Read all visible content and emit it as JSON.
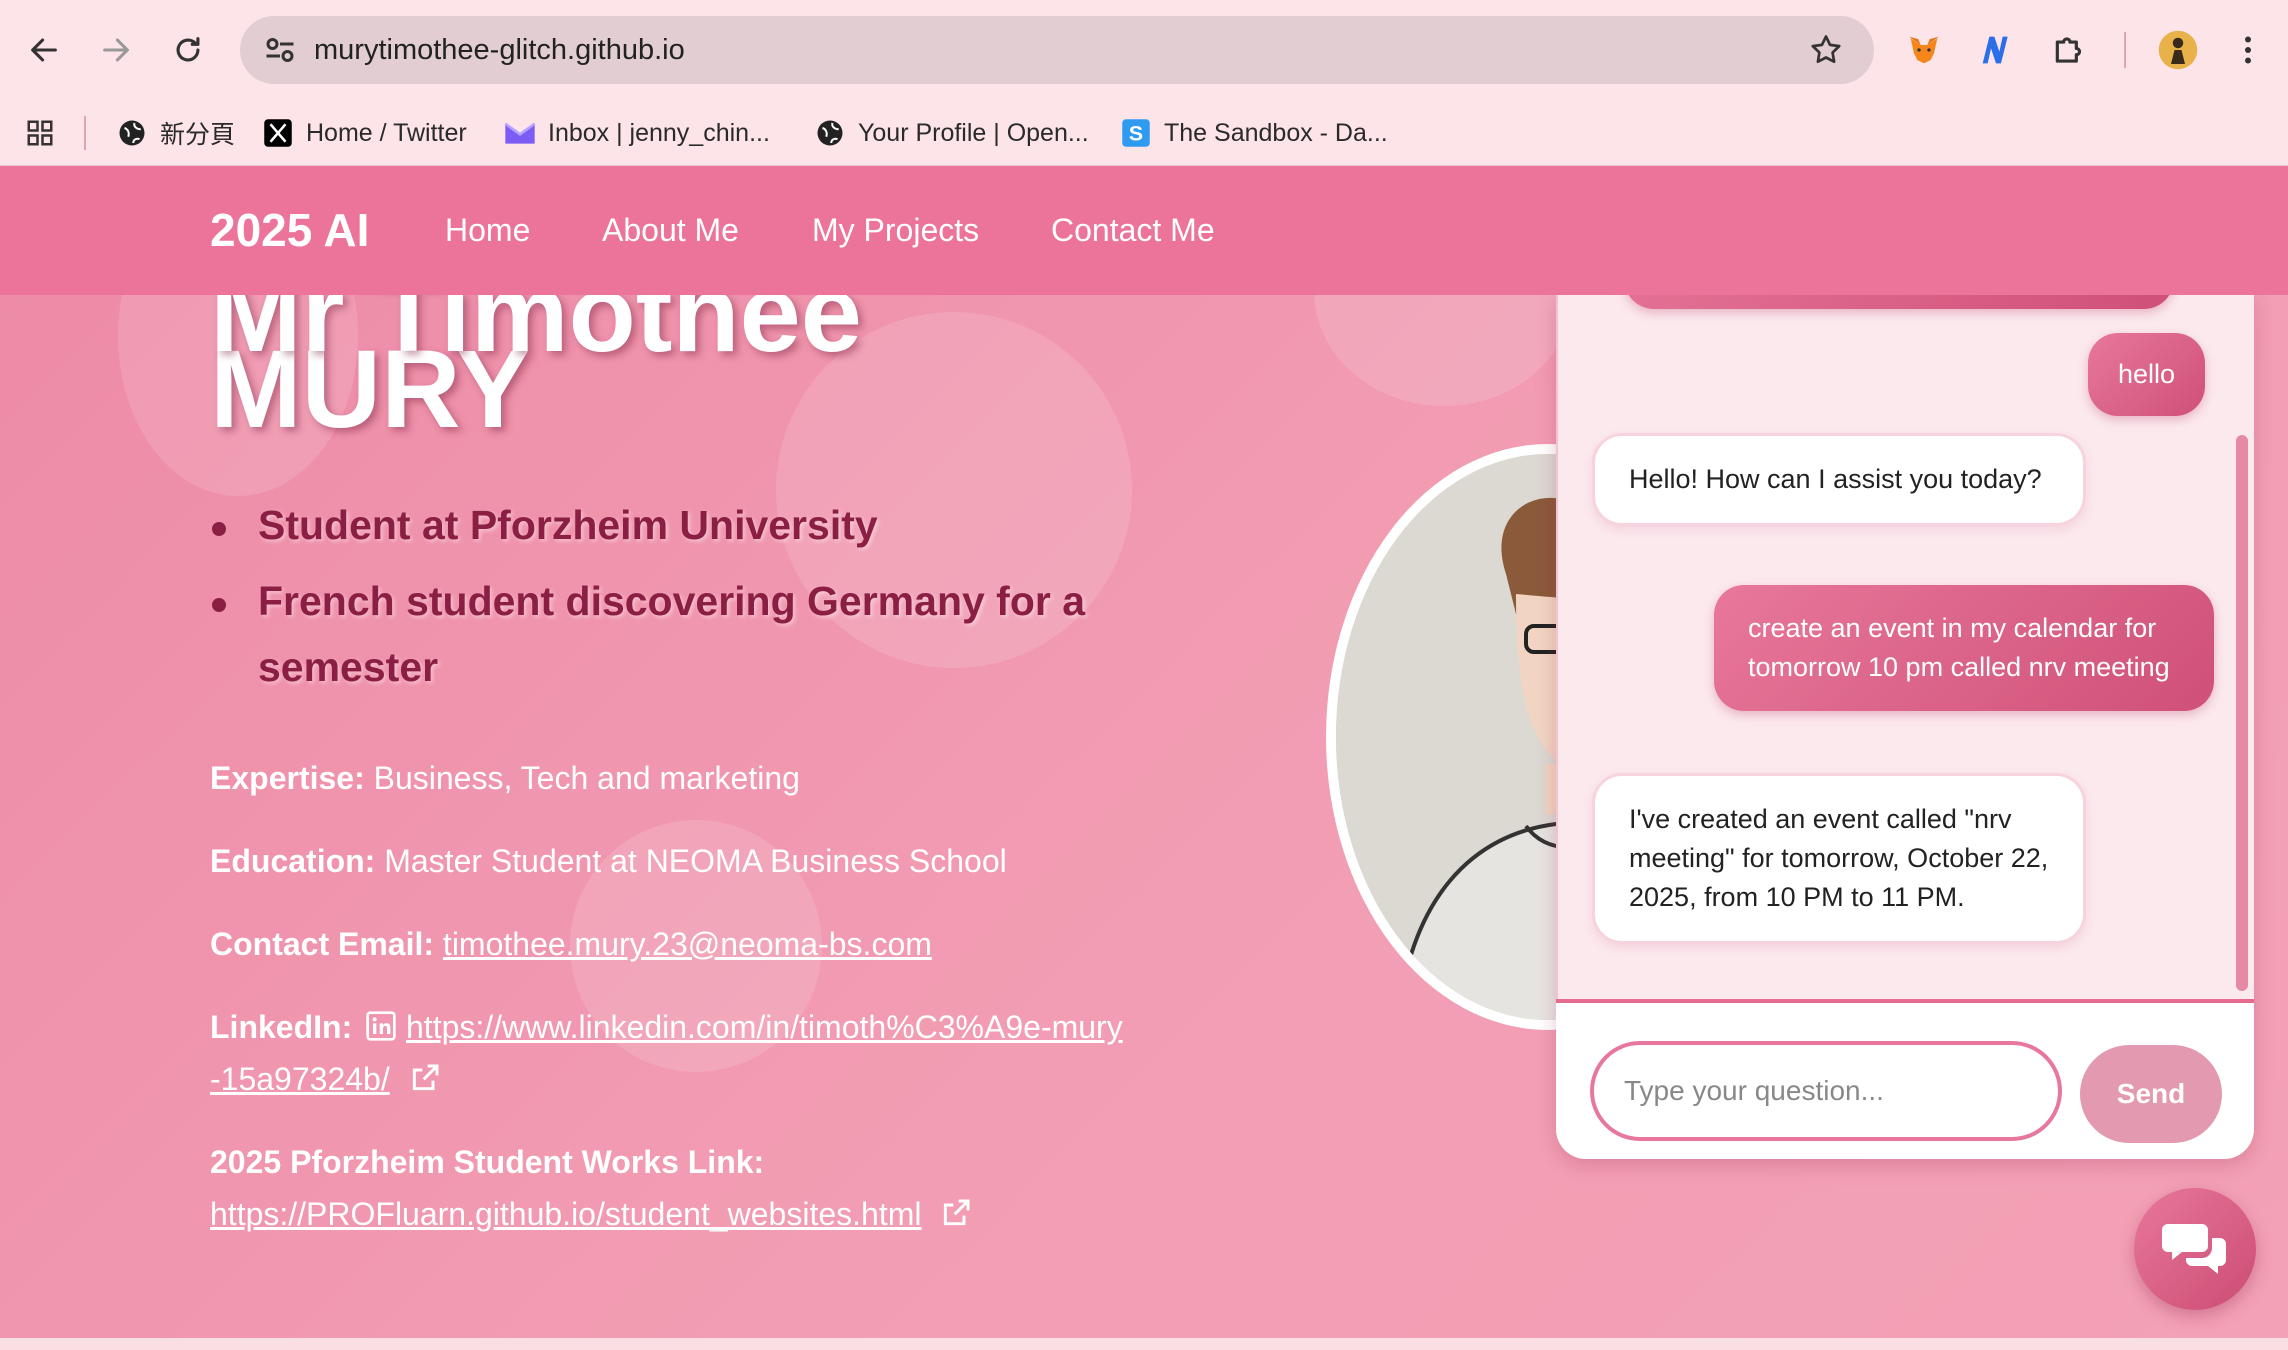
{
  "browser": {
    "url": "murytimothee-glitch.github.io",
    "bookmarks": [
      {
        "label": "新分頁",
        "icon": "globe-icon"
      },
      {
        "label": "Home / Twitter",
        "icon": "x-logo-icon"
      },
      {
        "label": "Inbox | jenny_chin...",
        "icon": "mail-icon"
      },
      {
        "label": "Your Profile | Open...",
        "icon": "globe-icon"
      },
      {
        "label": "The Sandbox - Da...",
        "icon": "sandbox-icon"
      }
    ],
    "extensions": [
      "metamask-icon",
      "n-extension-icon",
      "puzzle-icon",
      "profile-avatar",
      "kebab-menu-icon"
    ]
  },
  "site": {
    "brand": "2025 AI",
    "nav": [
      "Home",
      "About Me",
      "My Projects",
      "Contact Me"
    ]
  },
  "hero": {
    "top_line": "Mr Timothée",
    "name": "MURY",
    "bullets": [
      "Student at Pforzheim University",
      "French student discovering Germany for a semester"
    ]
  },
  "info": {
    "expertise_label": "Expertise:",
    "expertise_value": "Business, Tech and marketing",
    "education_label": "Education:",
    "education_value": "Master Student at NEOMA Business School",
    "email_label": "Contact Email:",
    "email_value": "timothee.mury.23@neoma-bs.com",
    "linkedin_label": "LinkedIn:",
    "linkedin_value": "https://www.linkedin.com/in/timoth%C3%A9e-mury-15a97324b/",
    "works_label": "2025 Pforzheim Student Works Link:",
    "works_value": "https://PROFluarn.github.io/student_websites.html"
  },
  "chat": {
    "messages": [
      {
        "role": "user",
        "text": "hello"
      },
      {
        "role": "bot",
        "text": "Hello! How can I assist you today?"
      },
      {
        "role": "user",
        "text": "create an event in my calendar for tomorrow 10 pm called nrv meeting"
      },
      {
        "role": "bot",
        "text": "I've created an event called \"nrv meeting\" for tomorrow, October 22, 2025, from 10 PM to 11 PM."
      }
    ],
    "input_value": "",
    "input_placeholder": "Type your question...",
    "send_label": "Send",
    "fab_icon": "chat-bubbles-icon"
  },
  "colors": {
    "header": "#ec7399",
    "page_bg": "#f29db3",
    "bullet_text": "#8a1f43",
    "user_bubble": "#d95f85",
    "send_button": "#e39ab0"
  }
}
